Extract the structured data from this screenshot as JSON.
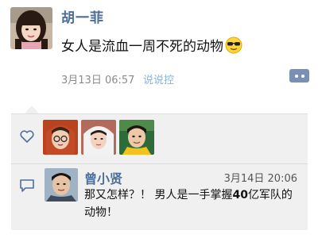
{
  "post": {
    "author": "胡一菲",
    "text": "女人是流血一周不死的动物",
    "emoji_icon": "cool-sunglasses-emoji",
    "time": "3月13日 06:57",
    "source": "说说控",
    "more_icon": "more-dots-icon"
  },
  "likes": {
    "icon": "heart-icon",
    "avatars": [
      {
        "name": "liker-avatar-1"
      },
      {
        "name": "liker-avatar-2"
      },
      {
        "name": "liker-avatar-3"
      }
    ]
  },
  "comment": {
    "icon": "comment-bubble-icon",
    "author": "曾小贤",
    "time": "3月14日 20:06",
    "text_before": "那又怎样？！ 男人是一手掌握",
    "text_bold": "40",
    "text_after": "亿军队的动物！"
  },
  "colors": {
    "name_blue": "#4c6e98",
    "panel_bg": "#f0f0f1",
    "more_button": "#7a8fb4",
    "source_blue": "#8ab2d9"
  }
}
